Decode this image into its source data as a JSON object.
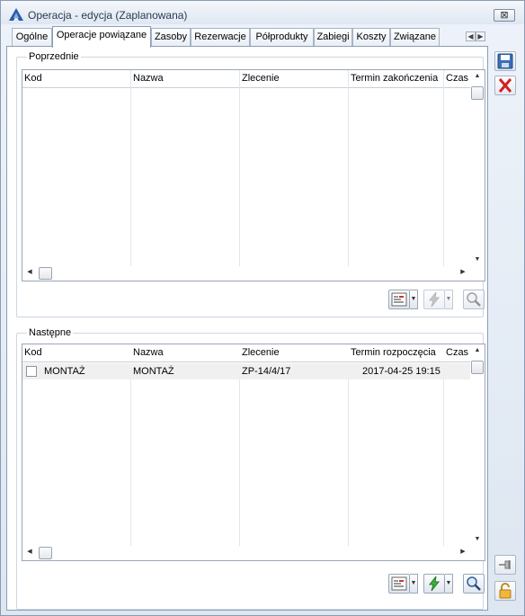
{
  "window": {
    "title": "Operacja - edycja (Zaplanowana)",
    "close_label": "⊠"
  },
  "tabs": [
    {
      "label": "Ogólne"
    },
    {
      "label": "Operacje powiązane",
      "active": true
    },
    {
      "label": "Zasoby"
    },
    {
      "label": "Rezerwacje"
    },
    {
      "label": "Półprodukty"
    },
    {
      "label": "Zabiegi"
    },
    {
      "label": "Koszty"
    },
    {
      "label": "Związane"
    }
  ],
  "poprzednie": {
    "label": "Poprzednie",
    "columns": [
      "Kod",
      "Nazwa",
      "Zlecenie",
      "Termin zakończenia",
      "Czas"
    ],
    "rows": []
  },
  "nastepne": {
    "label": "Następne",
    "columns": [
      "Kod",
      "Nazwa",
      "Zlecenie",
      "Termin rozpoczęcia",
      "Czas"
    ],
    "rows": [
      {
        "kod": "MONTAŻ",
        "nazwa": "MONTAŻ",
        "zlecenie": "ZP-14/4/17",
        "termin": "2017-04-25 19:15",
        "checked": false
      }
    ]
  },
  "icons": {
    "logo": "app-logo-triangle",
    "save": "save-disk-icon",
    "cancel": "red-x-icon",
    "filter": "filter-list-icon",
    "lightning": "lightning-icon",
    "search": "magnifier-icon",
    "pin": "pin-icon",
    "lock": "padlock-icon"
  },
  "colors": {
    "accent": "#2a5da8",
    "lightning_active": "#3db33d",
    "cancel_red": "#d32020"
  }
}
